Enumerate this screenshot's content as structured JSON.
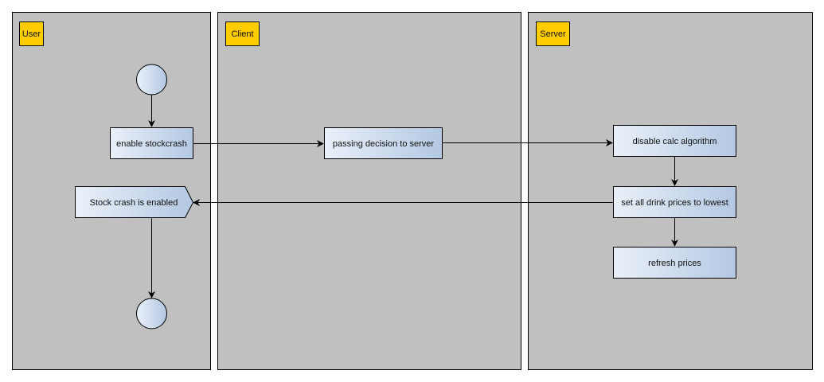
{
  "lanes": [
    {
      "label": "User"
    },
    {
      "label": "Client"
    },
    {
      "label": "Server"
    }
  ],
  "nodes": {
    "enable_stockcrash": "enable stockcrash",
    "passing_decision": "passing decision to server",
    "disable_calc": "disable calc algorithm",
    "set_prices": "set all drink prices to lowest",
    "refresh_prices": "refresh prices",
    "stock_crash_enabled": "Stock crash is enabled"
  },
  "colors": {
    "lane_fill": "#c0c0c0",
    "lane_label_fill": "#ffcc00",
    "node_gradient_start": "#eaf0f9",
    "node_gradient_end": "#b3c8e3"
  }
}
